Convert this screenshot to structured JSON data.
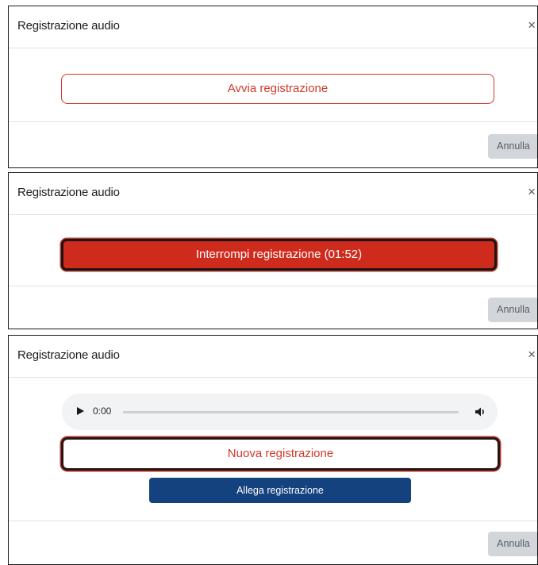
{
  "dialog_title": "Registrazione audio",
  "close_symbol": "×",
  "cancel_label": "Annulla",
  "state1": {
    "start_label": "Avvia registrazione"
  },
  "state2": {
    "stop_label": "Interrompi registrazione (01:52)"
  },
  "state3": {
    "player": {
      "current_time": "0:00",
      "progress": 0,
      "play_icon": "play-icon",
      "volume_icon": "volume-icon"
    },
    "new_label": "Nuova registrazione",
    "attach_label": "Allega registrazione"
  },
  "colors": {
    "accent_red": "#cf2b1d",
    "primary_blue": "#14427e",
    "cancel_gray": "#d2d5d9"
  }
}
